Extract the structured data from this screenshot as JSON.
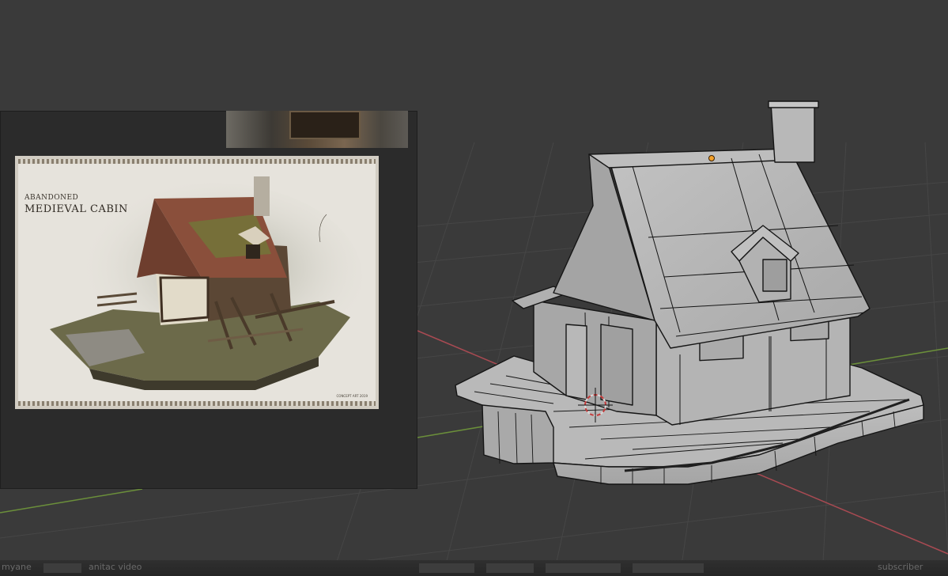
{
  "reference_image": {
    "small_title": "ABANDONED",
    "big_title": "MEDIEVAL CABIN",
    "credit": "CONCEPT ART 2019"
  },
  "bottom_bar": {
    "left_text": "myane",
    "mid_text": "anitac video",
    "right_text": "subscriber"
  },
  "colors": {
    "viewport_bg": "#3a3a3a",
    "grid_line": "#474747",
    "x_axis": "#a84a52",
    "y_axis": "#6b8f3a",
    "model_face": "#b4b4b4",
    "model_edge": "#151515",
    "origin_point": "#f2a02a"
  }
}
